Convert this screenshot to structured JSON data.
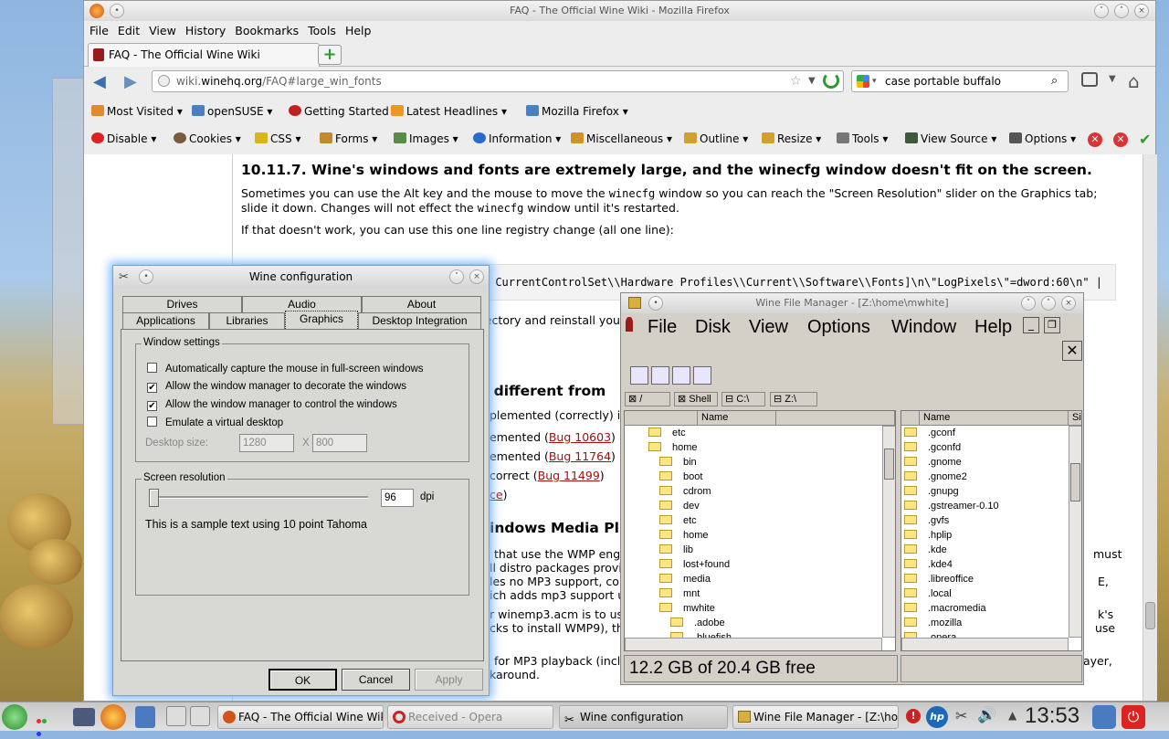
{
  "firefox": {
    "title": "FAQ - The Official Wine Wiki - Mozilla Firefox",
    "menu": [
      "File",
      "Edit",
      "View",
      "History",
      "Bookmarks",
      "Tools",
      "Help"
    ],
    "tab_title": "FAQ - The Official Wine Wiki",
    "url_prefix": "wiki.",
    "url_domain": "winehq.org",
    "url_path": "/FAQ#large_win_fonts",
    "search_value": "case portable buffalo",
    "bookmarks": [
      "Most Visited",
      "openSUSE",
      "Getting Started",
      "Latest Headlines",
      "Mozilla Firefox"
    ],
    "devtools": [
      "Disable",
      "Cookies",
      "CSS",
      "Forms",
      "Images",
      "Information",
      "Miscellaneous",
      "Outline",
      "Resize",
      "Tools",
      "View Source",
      "Options"
    ]
  },
  "article": {
    "heading": "10.11.7. Wine's windows and fonts are extremely large, and the winecfg window doesn't fit on the screen.",
    "para1_a": "Sometimes you can use the Alt key and the mouse to move the ",
    "para1_code": "winecfg",
    "para1_b": " window so you can reach the \"Screen Resolution\" slider on the Graphics tab; slide it down. Changes will not effect the ",
    "para1_code2": "winecfg",
    "para1_c": " window until it's restarted.",
    "para2": "If that doesn't work, you can use this one line registry change (all one line):",
    "code": "CurrentControlSet\\\\Hardware Profiles\\\\Current\\\\Software\\\\Fonts]\\n\\\"LogPixels\\\"=dword:60\\n\" |",
    "frag_reinstall": "rectory and reinstall you",
    "frag_heading1": "s different from",
    "frag_impl": "plemented (correctly) i",
    "frag_b1": "emented (",
    "bug1": "Bug 10603",
    "frag_b2": "emented (",
    "bug2": "Bug 11764",
    "frag_b3": "correct (",
    "bug3": "Bug 11499",
    "frag_link": "ce",
    "frag_heading2": "indows Media Pl",
    "frag_l1": "that use the WMP engi",
    "frag_l1r": "must",
    "frag_l2": "ll distro packages provi",
    "frag_l3": "les no MP3 support, co",
    "frag_l3r": "E,",
    "frag_l4": "ich adds mp3 support u",
    "frag_l5": "r winemp3.acm is to use",
    "frag_l5r": "k's",
    "frag_l6": "cks to install WMP9), th",
    "frag_l6r": "use",
    "frag_l7": "for MP3 playback (inclu",
    "frag_l7r": "ayer,",
    "frag_l8": "karound."
  },
  "winecfg": {
    "title": "Wine configuration",
    "tabs_row1": [
      "Drives",
      "Audio",
      "About"
    ],
    "tabs_row2": [
      "Applications",
      "Libraries",
      "Graphics",
      "Desktop Integration"
    ],
    "window_settings": "Window settings",
    "opt1": "Automatically capture the mouse in full-screen windows",
    "opt2": "Allow the window manager to decorate the windows",
    "opt3": "Allow the window manager to control the windows",
    "opt4": "Emulate a virtual desktop",
    "desktop_size_label": "Desktop size:",
    "width": "1280",
    "x": "X",
    "height": "800",
    "screen_resolution": "Screen resolution",
    "dpi_value": "96",
    "dpi_unit": "dpi",
    "sample": "This is a sample text using 10 point Tahoma",
    "ok": "OK",
    "cancel": "Cancel",
    "apply": "Apply"
  },
  "winefile": {
    "title": "Wine File Manager - [Z:\\home\\mwhite]",
    "menu": [
      "File",
      "Disk",
      "View",
      "Options",
      "Window",
      "Help"
    ],
    "drives": [
      "/",
      "Shell",
      "C:\\",
      "Z:\\"
    ],
    "col_name": "Name",
    "col_size": "Siz",
    "tree": [
      "etc",
      "home",
      "bin",
      "boot",
      "cdrom",
      "dev",
      "etc",
      "home",
      "lib",
      "lost+found",
      "media",
      "mnt",
      "mwhite",
      ".adobe",
      ".bluefish"
    ],
    "files": [
      ".gconf",
      ".gconfd",
      ".gnome",
      ".gnome2",
      ".gnupg",
      ".gstreamer-0.10",
      ".gvfs",
      ".hplip",
      ".kde",
      ".kde4",
      ".libreoffice",
      ".local",
      ".macromedia",
      ".mozilla",
      ".opera"
    ],
    "status": "12.2 GB of 20.4 GB free"
  },
  "taskbar": {
    "tasks": [
      "FAQ - The Official Wine Wiki",
      "Received - Opera",
      "Wine configuration",
      "Wine File Manager - [Z:\\hom"
    ],
    "clock": "13:53"
  }
}
